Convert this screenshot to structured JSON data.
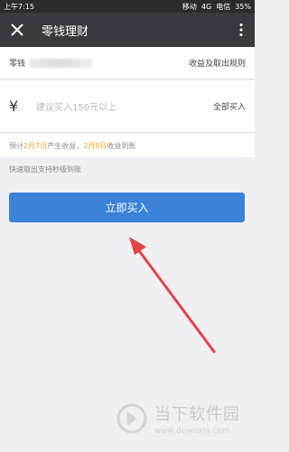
{
  "status": {
    "time": "上午7:15",
    "carrier1": "移动",
    "network": "4G",
    "carrier2": "电信",
    "battery": "35%"
  },
  "titlebar": {
    "title": "零钱理财"
  },
  "row1": {
    "label": "零钱",
    "link": "收益及取出规则"
  },
  "amount": {
    "symbol": "¥",
    "placeholder": "建议买入150元以上",
    "all": "全部买入"
  },
  "expect": {
    "pre": "预计",
    "date1": "2月7日",
    "mid": "产生收益，",
    "date2": "2月8日",
    "post": "收益到账"
  },
  "tip": "快速取出支持秒级到账",
  "button": "立即买入",
  "watermark": {
    "cn": "当下软件园",
    "en": "www.downxia.com"
  },
  "colors": {
    "primary": "#3b82d8",
    "highlight": "#f5a623",
    "arrow": "#e34343"
  }
}
